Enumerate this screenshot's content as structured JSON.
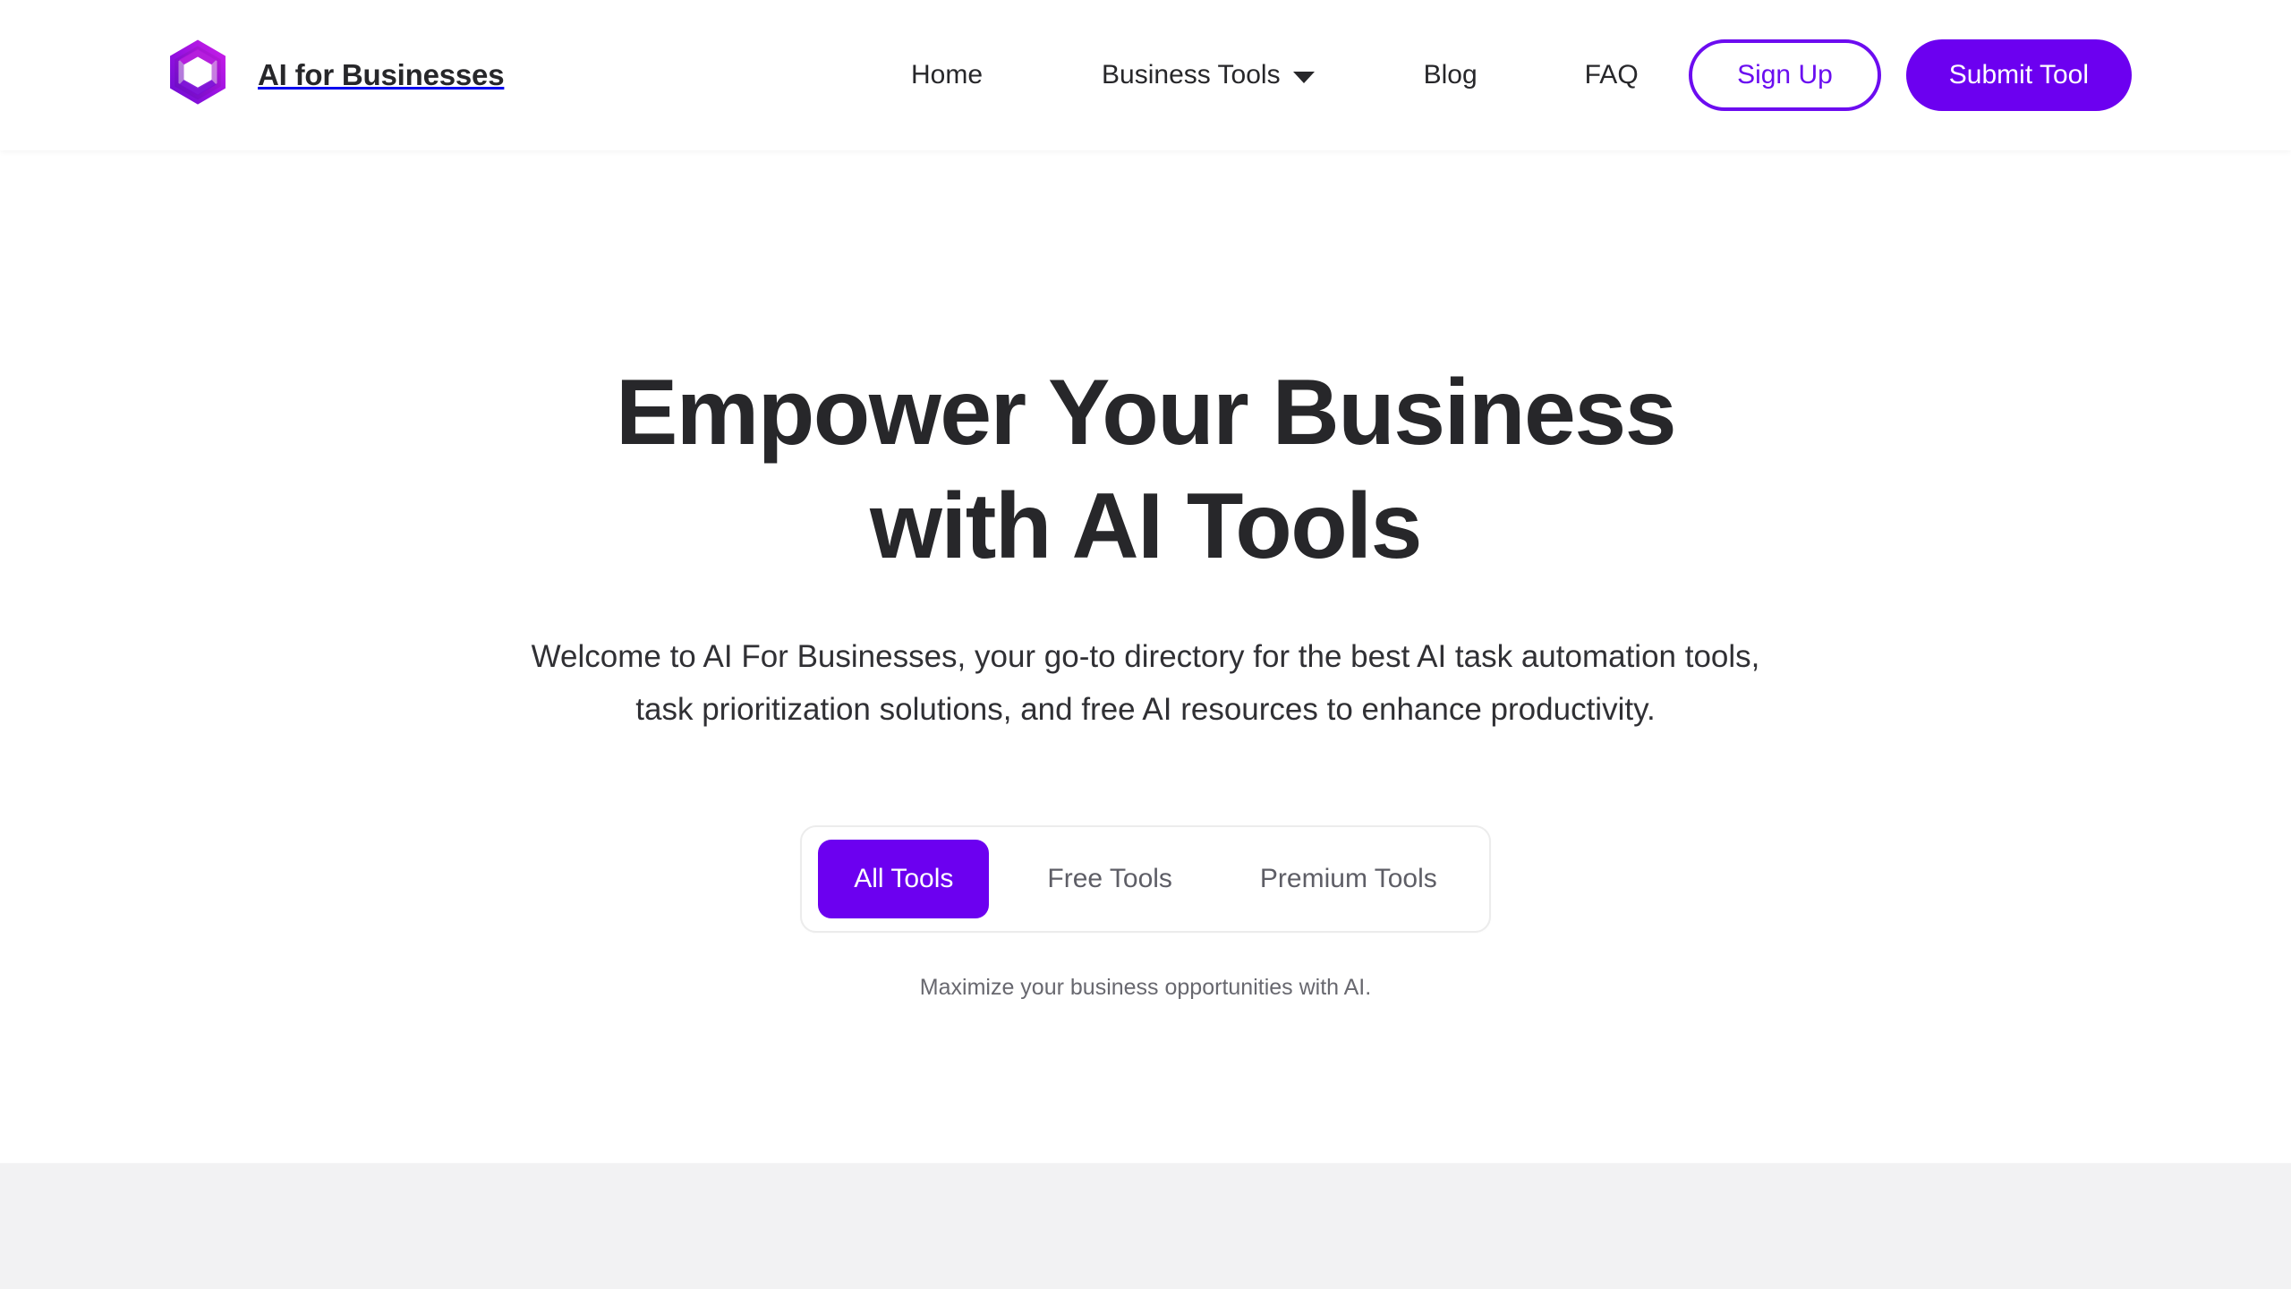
{
  "theme": {
    "accent_purple": "#6C00F0",
    "accent_purple_text": "#6A0DF0",
    "logo_gradient_start": "#6A0DD0",
    "logo_gradient_end": "#D11FE8",
    "heading_color": "#27272A",
    "body_color": "#303034",
    "muted_color": "#68686F",
    "band_bg": "#F2F2F3",
    "page_bg": "#FFFFFF"
  },
  "header": {
    "brand_name": "AI for Businesses",
    "logo_icon": "hexagon-loop-logo-icon",
    "nav": [
      {
        "label": "Home",
        "has_dropdown": false,
        "dropdown_icon": ""
      },
      {
        "label": "Business Tools",
        "has_dropdown": true,
        "dropdown_icon": "chevron-down-icon"
      },
      {
        "label": "Blog",
        "has_dropdown": false,
        "dropdown_icon": ""
      },
      {
        "label": "FAQ",
        "has_dropdown": false,
        "dropdown_icon": ""
      }
    ],
    "sign_up_label": "Sign Up",
    "submit_tool_label": "Submit Tool"
  },
  "hero": {
    "title_line_1": "Empower Your Business",
    "title_line_2": "with AI Tools",
    "subtitle": "Welcome to AI For Businesses, your go-to directory for the best AI task automation tools, task prioritization solutions, and free AI resources to enhance productivity."
  },
  "filters": {
    "tabs": [
      {
        "label": "All Tools",
        "active": true
      },
      {
        "label": "Free Tools",
        "active": false
      },
      {
        "label": "Premium Tools",
        "active": false
      }
    ],
    "caption": "Maximize your business opportunities with AI."
  }
}
